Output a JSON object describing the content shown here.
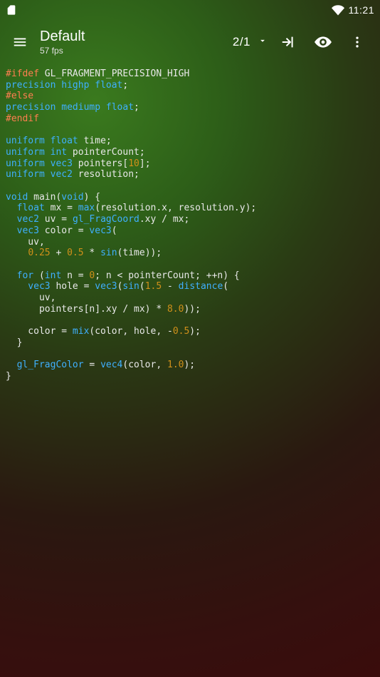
{
  "statusbar": {
    "time": "11:21"
  },
  "toolbar": {
    "title": "Default",
    "subtitle": "57 fps",
    "counter": "2/1"
  },
  "code": {
    "l1": {
      "a": "#ifdef",
      "b": " GL_FRAGMENT_PRECISION_HIGH"
    },
    "l2": {
      "a": "precision",
      "b": " highp",
      "c": " float",
      "d": ";"
    },
    "l3": {
      "a": "#else"
    },
    "l4": {
      "a": "precision",
      "b": " mediump",
      "c": " float",
      "d": ";"
    },
    "l5": {
      "a": "#endif"
    },
    "l7": {
      "a": "uniform",
      "b": " float",
      "c": " time;"
    },
    "l8": {
      "a": "uniform",
      "b": " int",
      "c": " pointerCount;"
    },
    "l9": {
      "a": "uniform",
      "b": " vec3",
      "c": " pointers[",
      "d": "10",
      "e": "];"
    },
    "l10": {
      "a": "uniform",
      "b": " vec2",
      "c": " resolution;"
    },
    "l12": {
      "a": "void",
      "b": " main(",
      "c": "void",
      "d": ") {"
    },
    "l13": {
      "a": "  float",
      "b": " mx = ",
      "c": "max",
      "d": "(resolution.x, resolution.y);"
    },
    "l14": {
      "a": "  vec2",
      "b": " uv = ",
      "c": "gl_FragCoord",
      "d": ".xy / mx;"
    },
    "l15": {
      "a": "  vec3",
      "b": " color = ",
      "c": "vec3",
      "d": "("
    },
    "l16": {
      "a": "    uv,"
    },
    "l17": {
      "a": "    ",
      "b": "0.25",
      "c": " + ",
      "d": "0.5",
      "e": " * ",
      "f": "sin",
      "g": "(time));"
    },
    "l19": {
      "a": "  for",
      "b": " (",
      "c": "int",
      "d": " n = ",
      "e": "0",
      "f": "; n < pointerCount; ++n) {"
    },
    "l20": {
      "a": "    vec3",
      "b": " hole = ",
      "c": "vec3",
      "d": "(",
      "e": "sin",
      "f": "(",
      "g": "1.5",
      "h": " - ",
      "i": "distance",
      "j": "("
    },
    "l21": {
      "a": "      uv,"
    },
    "l22": {
      "a": "      pointers[n].xy / mx) * ",
      "b": "8.0",
      "c": "));"
    },
    "l24": {
      "a": "    color = ",
      "b": "mix",
      "c": "(color, hole, -",
      "d": "0.5",
      "e": ");"
    },
    "l25": {
      "a": "  }"
    },
    "l27": {
      "a": "  gl_FragColor",
      "b": " = ",
      "c": "vec4",
      "d": "(color, ",
      "e": "1.0",
      "f": ");"
    },
    "l28": {
      "a": "}"
    }
  }
}
